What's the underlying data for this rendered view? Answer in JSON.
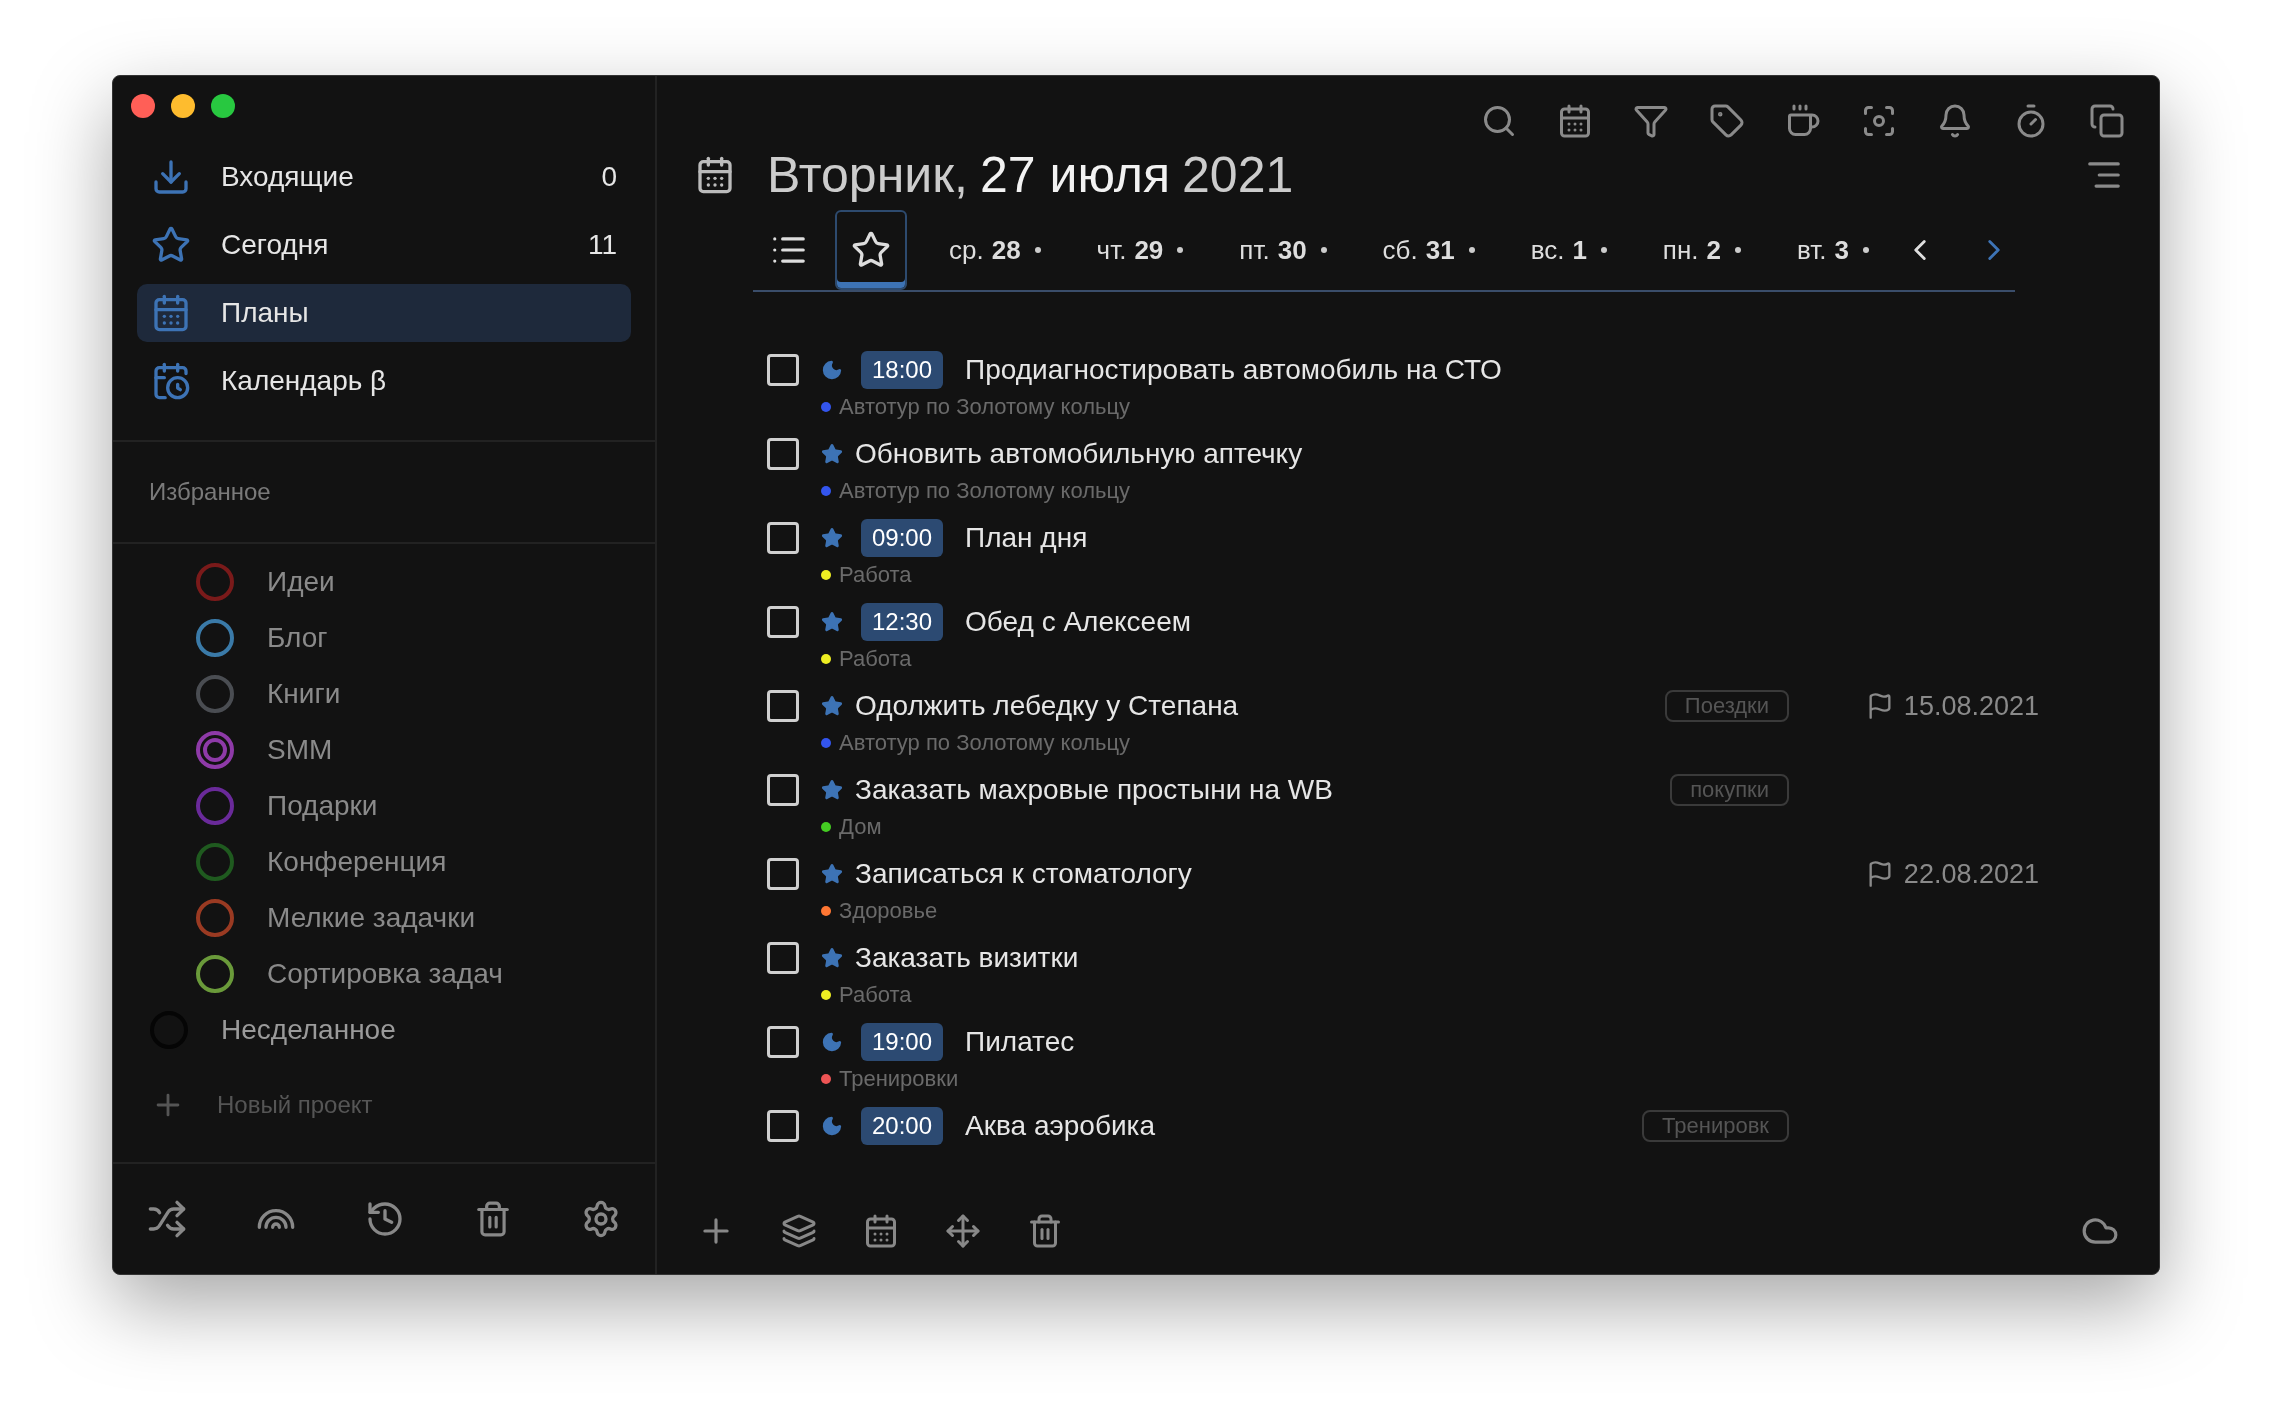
{
  "sidebar": {
    "nav": [
      {
        "kind": "inbox",
        "label": "Входящие",
        "count": "0",
        "selected": false
      },
      {
        "kind": "today",
        "label": "Сегодня",
        "count": "11",
        "selected": false
      },
      {
        "kind": "plans",
        "label": "Планы",
        "selected": true
      },
      {
        "kind": "calendar",
        "label": "Календарь β",
        "selected": false
      }
    ],
    "favorites_title": "Избранное",
    "projects": [
      {
        "kind": "ring",
        "label": "Идеи",
        "color": "#7a1a1a"
      },
      {
        "kind": "ring",
        "label": "Блог",
        "color": "#3a7aa8"
      },
      {
        "kind": "ring",
        "label": "Книги",
        "color": "#4a4d52"
      },
      {
        "kind": "double",
        "label": "SMM",
        "color": "#8e3aa8"
      },
      {
        "kind": "ring",
        "label": "Подарки",
        "color": "#6a2a9a"
      },
      {
        "kind": "ring",
        "label": "Конференция",
        "color": "#1f5a1f"
      },
      {
        "kind": "ring",
        "label": "Мелкие задачки",
        "color": "#9a3a22"
      },
      {
        "kind": "ring",
        "label": "Сортировка задач",
        "color": "#6a9a3a"
      }
    ],
    "undone": {
      "label": "Несделанное"
    },
    "new_project": "Новый проект"
  },
  "header": {
    "weekday": "Вторник,",
    "date": "27 июля",
    "year": "2021"
  },
  "tabs": [
    {
      "kind": "list",
      "selected": false
    },
    {
      "kind": "star",
      "selected": true
    },
    {
      "kind": "day",
      "weekday": "ср.",
      "day": "28",
      "selected": false
    },
    {
      "kind": "day",
      "weekday": "чт.",
      "day": "29",
      "selected": false
    },
    {
      "kind": "day",
      "weekday": "пт.",
      "day": "30",
      "selected": false
    },
    {
      "kind": "day",
      "weekday": "сб.",
      "day": "31",
      "selected": false
    },
    {
      "kind": "day",
      "weekday": "вс.",
      "day": "1",
      "selected": false
    },
    {
      "kind": "day",
      "weekday": "пн.",
      "day": "2",
      "selected": false
    },
    {
      "kind": "day",
      "weekday": "вт.",
      "day": "3",
      "selected": false
    }
  ],
  "tasks": [
    {
      "kind": "evening",
      "time": "18:00",
      "title": "Продиагностировать автомобиль на СТО",
      "project": "Автотур по Золотому кольцу",
      "color": "#3355ee",
      "checked": false
    },
    {
      "kind": "today",
      "title": "Обновить автомобильную аптечку",
      "project": "Автотур по Золотому кольцу",
      "color": "#3355ee",
      "checked": false
    },
    {
      "kind": "today",
      "time": "09:00",
      "title": "План дня",
      "project": "Работа",
      "color": "#eeee22",
      "checked": false
    },
    {
      "kind": "today",
      "time": "12:30",
      "title": "Обед с Алексеем",
      "project": "Работа",
      "color": "#eeee22",
      "checked": false
    },
    {
      "kind": "today",
      "title": "Одолжить лебедку у Степана",
      "project": "Автотур по Золотому кольцу",
      "color": "#3355ee",
      "tag": "Поездки",
      "due": "15.08.2021",
      "checked": false
    },
    {
      "kind": "today",
      "title": "Заказать махровые простыни на WB",
      "project": "Дом",
      "color": "#44cc22",
      "tag": "покупки",
      "checked": false
    },
    {
      "kind": "today",
      "title": "Записаться к стоматологу",
      "project": "Здоровье",
      "color": "#ff7733",
      "due": "22.08.2021",
      "checked": false
    },
    {
      "kind": "today",
      "title": "Заказать визитки",
      "project": "Работа",
      "color": "#eeee22",
      "checked": false
    },
    {
      "kind": "evening",
      "time": "19:00",
      "title": "Пилатес",
      "project": "Тренировки",
      "color": "#ee5555",
      "checked": false
    },
    {
      "kind": "evening",
      "time": "20:00",
      "title": "Аква аэробика",
      "tag": "Тренировк",
      "checked": false
    }
  ]
}
